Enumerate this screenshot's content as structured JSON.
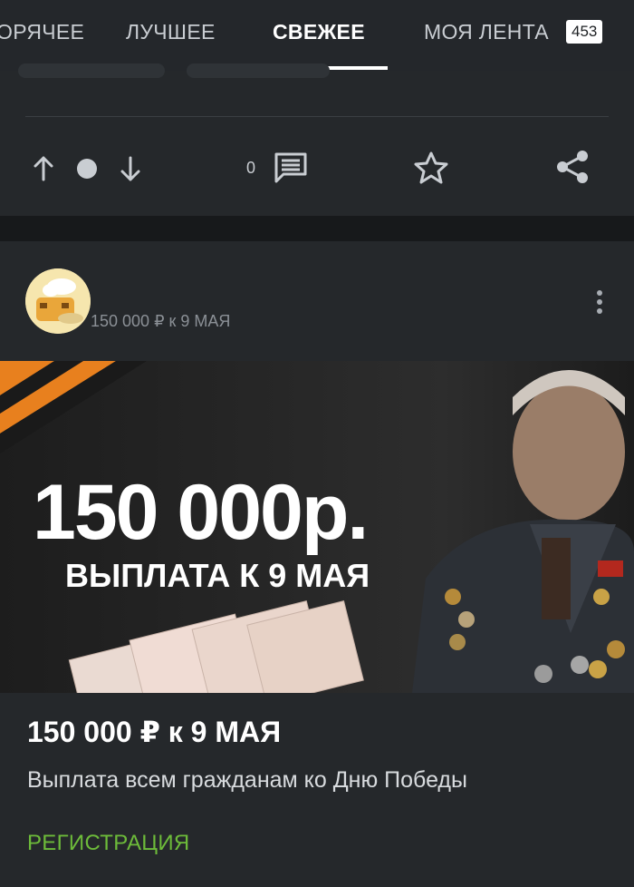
{
  "tabs": [
    {
      "label": "ОРЯЧЕЕ"
    },
    {
      "label": "ЛУЧШЕЕ"
    },
    {
      "label": "СВЕЖЕЕ",
      "active": true
    },
    {
      "label": "МОЯ ЛЕНТА"
    }
  ],
  "feed_badge": "453",
  "prev_post": {
    "comment_count": "0",
    "icons": [
      "arrow-up-icon",
      "dot-icon",
      "arrow-down-icon",
      "comment-icon",
      "star-icon",
      "share-icon"
    ]
  },
  "post": {
    "author_line": "150 000 ₽ к 9 МАЯ",
    "banner": {
      "headline": "150 000р.",
      "subline": "ВЫПЛАТА К 9 МАЯ"
    },
    "title": "150 000 ₽ к 9 МАЯ",
    "description": "Выплата всем гражданам ко Дню Победы",
    "link_label": "РЕГИСТРАЦИЯ"
  },
  "colors": {
    "background": "#17191b",
    "card": "#25282b",
    "tabbar": "#24272b",
    "accent_green": "#6dbb3a",
    "ribbon_orange": "#e8801e"
  }
}
